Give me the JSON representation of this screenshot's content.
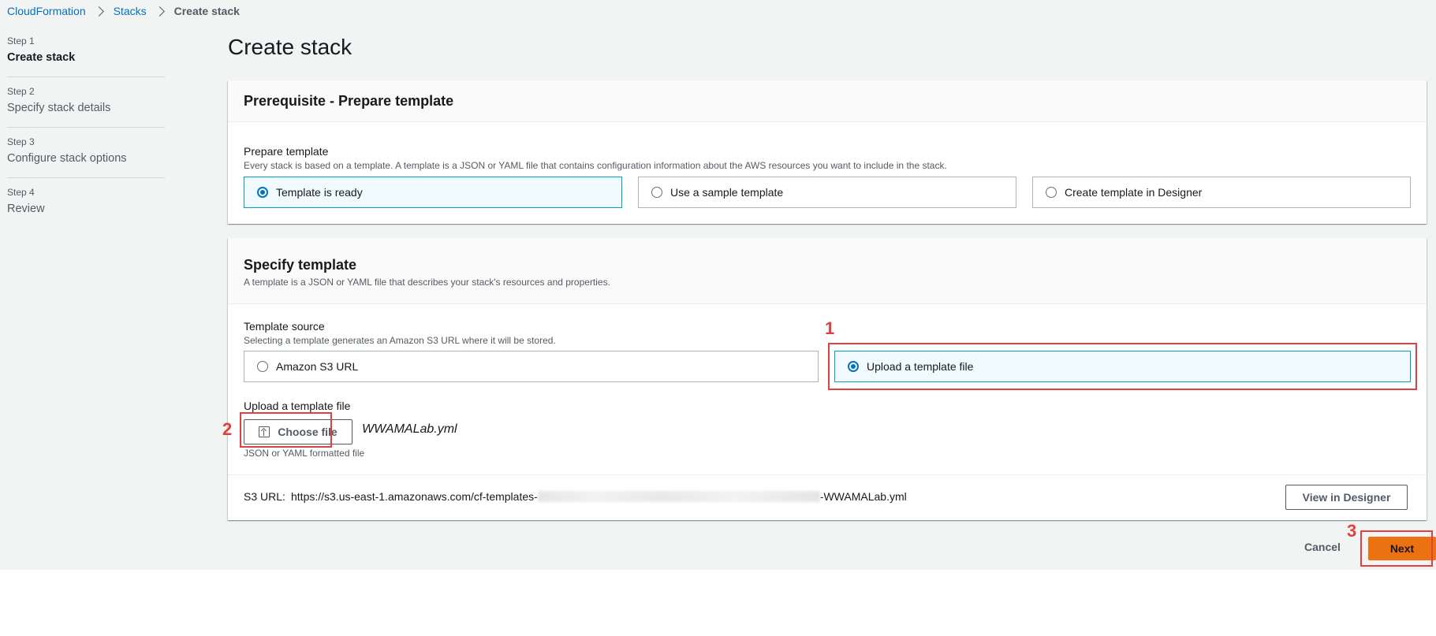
{
  "breadcrumb": {
    "items": [
      "CloudFormation",
      "Stacks"
    ],
    "current": "Create stack"
  },
  "steps": [
    {
      "num": "Step 1",
      "title": "Create stack",
      "active": true
    },
    {
      "num": "Step 2",
      "title": "Specify stack details",
      "active": false
    },
    {
      "num": "Step 3",
      "title": "Configure stack options",
      "active": false
    },
    {
      "num": "Step 4",
      "title": "Review",
      "active": false
    }
  ],
  "page_title": "Create stack",
  "prerequisite": {
    "title": "Prerequisite - Prepare template",
    "field_label": "Prepare template",
    "field_desc": "Every stack is based on a template. A template is a JSON or YAML file that contains configuration information about the AWS resources you want to include in the stack.",
    "options": [
      "Template is ready",
      "Use a sample template",
      "Create template in Designer"
    ],
    "selected": "Template is ready"
  },
  "specify": {
    "title": "Specify template",
    "desc": "A template is a JSON or YAML file that describes your stack's resources and properties.",
    "source_label": "Template source",
    "source_desc": "Selecting a template generates an Amazon S3 URL where it will be stored.",
    "source_options": [
      "Amazon S3 URL",
      "Upload a template file"
    ],
    "selected": "Upload a template file",
    "upload_label": "Upload a template file",
    "choose_file_label": "Choose file",
    "file_name": "WWAMALab.yml",
    "upload_hint": "JSON or YAML formatted file",
    "s3_label": "S3 URL:",
    "s3_url_prefix": "https://s3.us-east-1.amazonaws.com/cf-templates-",
    "s3_url_suffix": "-WWAMALab.yml",
    "view_designer_label": "View in Designer"
  },
  "actions": {
    "cancel": "Cancel",
    "next": "Next"
  },
  "annotations": [
    "1",
    "2",
    "3"
  ],
  "colors": {
    "link": "#0073bb",
    "primary": "#ec7211",
    "selected_border": "#00a1c9",
    "annotation": "#e0403e"
  }
}
